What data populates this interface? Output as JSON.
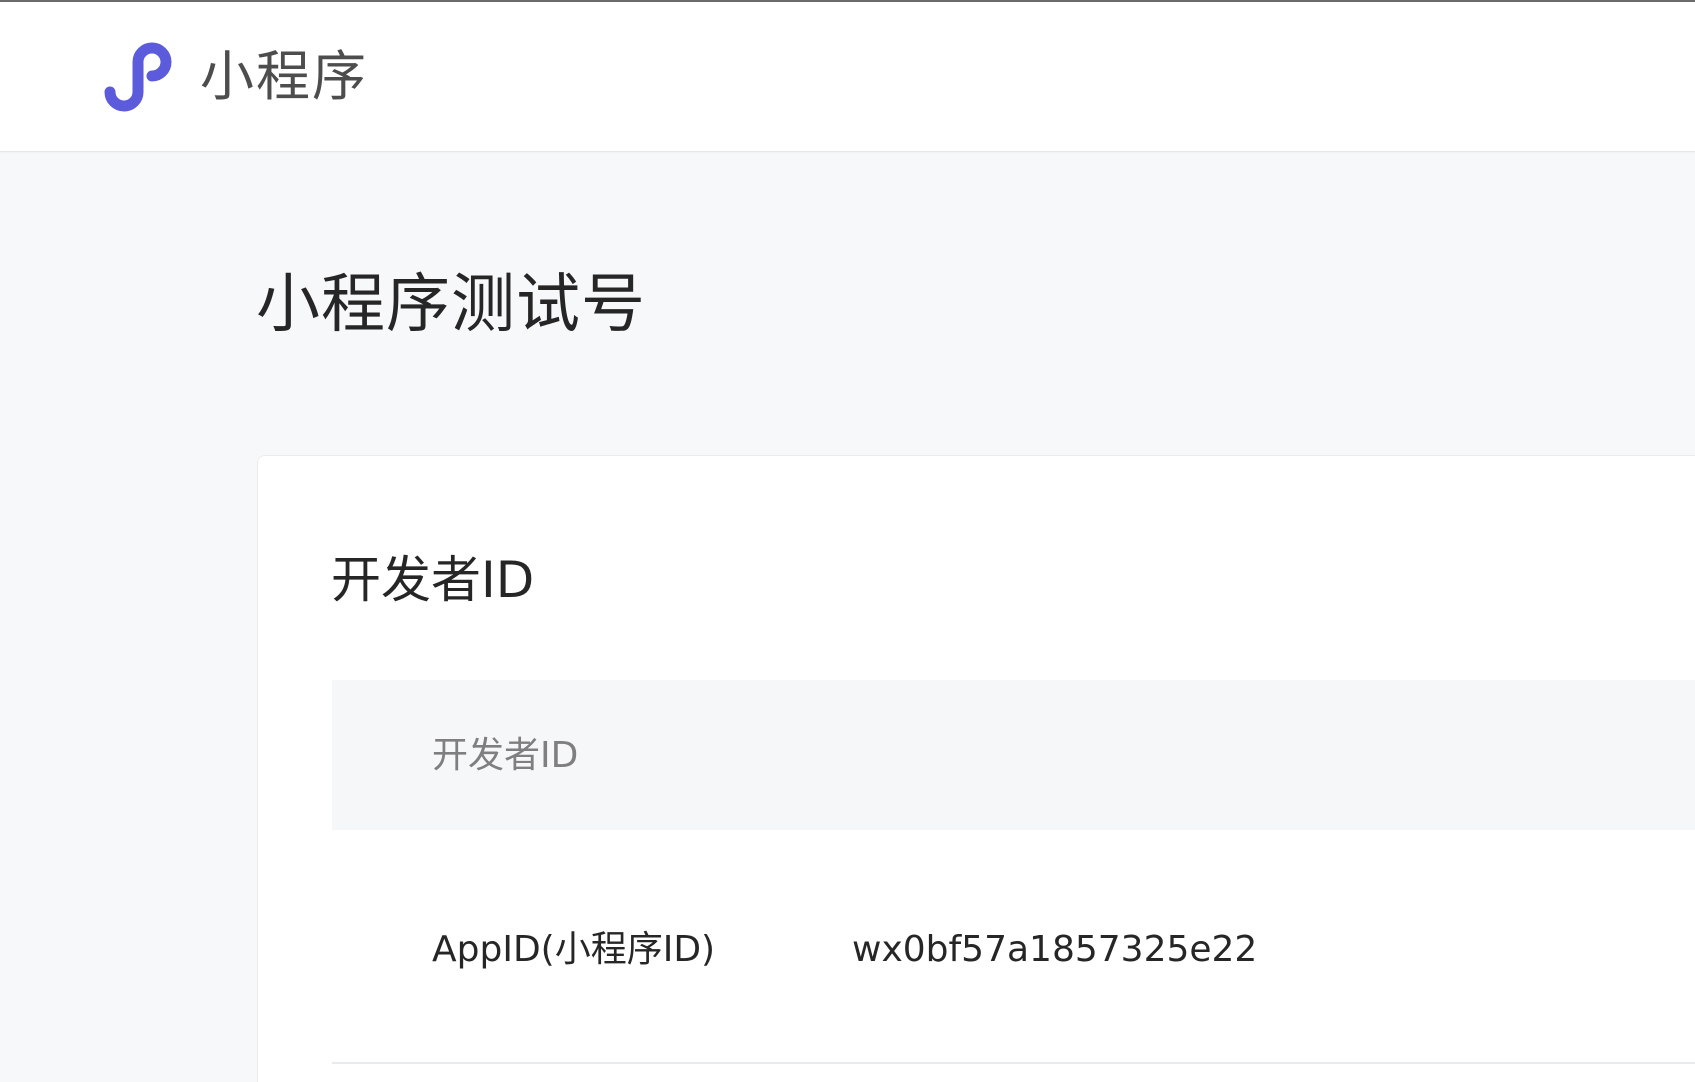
{
  "header": {
    "logo_icon": "mini-program-logo-icon",
    "brand_title": "小程序",
    "logo_color": "#5b5bdc"
  },
  "page": {
    "title": "小程序测试号"
  },
  "developer_id_section": {
    "title": "开发者ID",
    "table": {
      "columns": [
        "开发者ID"
      ],
      "rows": [
        {
          "label": "AppID(小程序ID)",
          "value": "wx0bf57a1857325e22"
        }
      ]
    }
  }
}
